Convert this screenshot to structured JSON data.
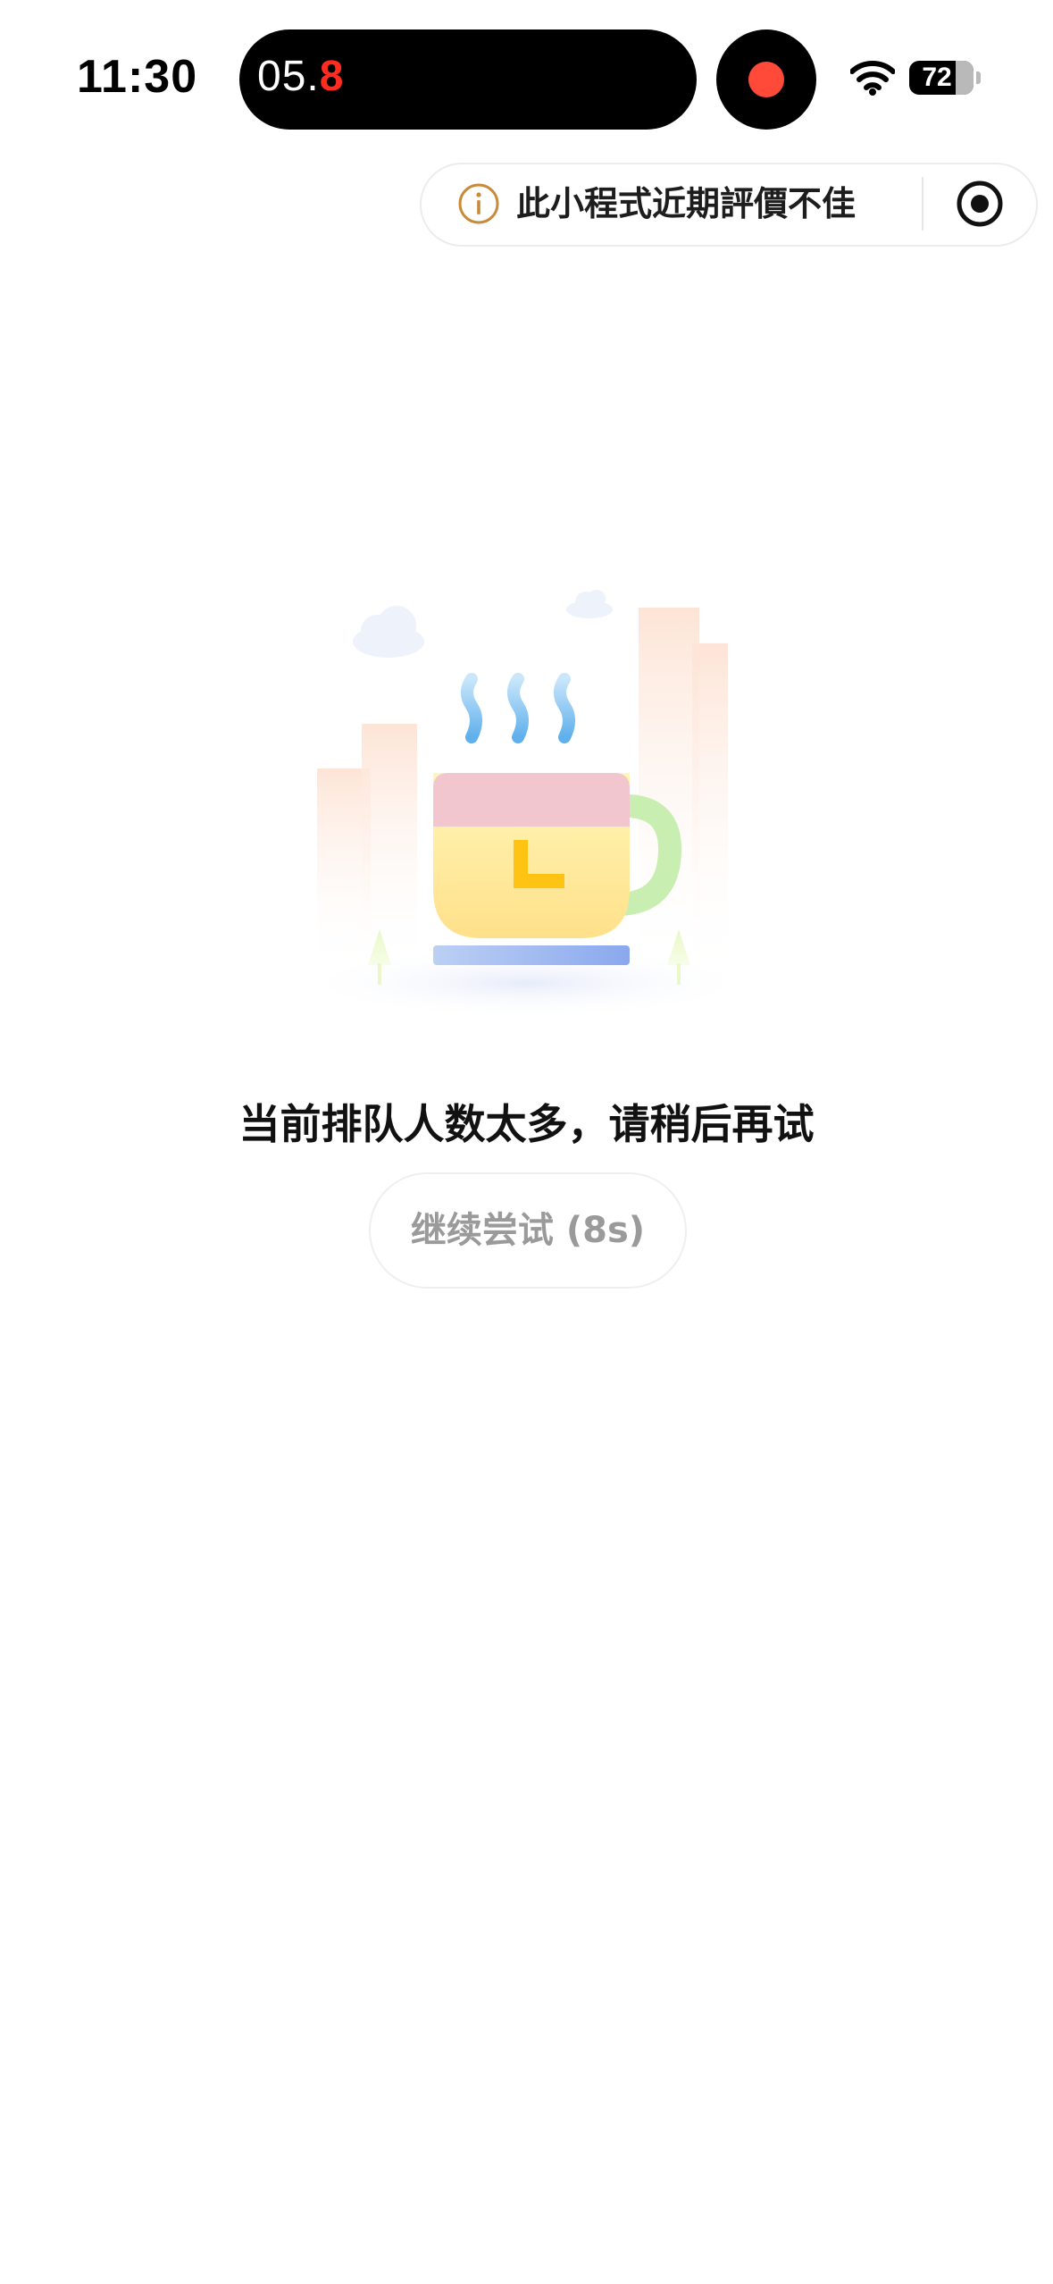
{
  "status_bar": {
    "time": "11:30",
    "recording_timer_prefix": "05.",
    "recording_timer_suffix": "8",
    "battery_level": "72",
    "icons": [
      "wifi-icon",
      "battery-icon",
      "record-icon"
    ],
    "colors": {
      "recording_accent": "#ff2d1f",
      "record_dot": "#ff4a3a"
    }
  },
  "capsule": {
    "warning_text": "此小程式近期評價不佳",
    "icons": [
      "info-icon",
      "target-icon"
    ],
    "warning_icon_color": "#c98a3a"
  },
  "main": {
    "illustration": "coffee-cup-illustration",
    "message": "当前排队人数太多，请稍后再试",
    "retry_button_label": "继续尝试 (8s)"
  }
}
